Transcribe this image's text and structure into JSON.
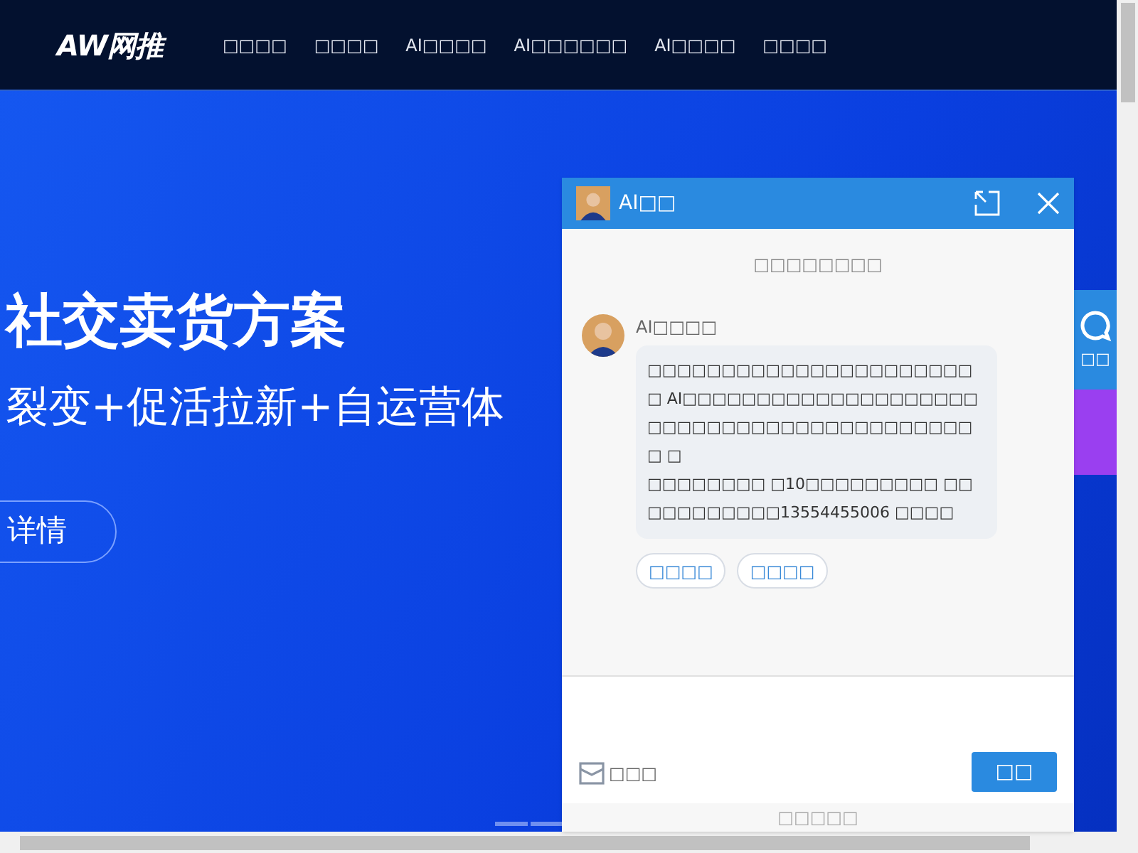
{
  "nav": {
    "logo": "AW网推",
    "items": [
      "□□□□",
      "□□□□",
      "AI□□□□",
      "AI□□□□□□",
      "AI□□□□",
      "□□□□"
    ]
  },
  "hero": {
    "title": "社交卖货方案",
    "subtitle": "裂变+促活拉新+自运营体",
    "button": "详情"
  },
  "side_widget": {
    "label": "□□"
  },
  "chat": {
    "title": "AI□□",
    "notice": "□□□□□□□□",
    "message": {
      "sender": "AI□□□□",
      "paragraphs": [
        "□□□□□□□□□□□□□□□□□□□□□□□ AI□□□□□□□□□□□□□□□□□□□□□□□□□□□□□□□□□□□□□□□□□□□ □",
        "□□□□□□□□ □10□□□□□□□□□ □□□□□□□□□□□13554455006 □□□□"
      ]
    },
    "quick_replies": [
      "□□□□",
      "□□□□"
    ],
    "message_label": "□□□",
    "send": "□□",
    "footer": "□□□□□"
  }
}
